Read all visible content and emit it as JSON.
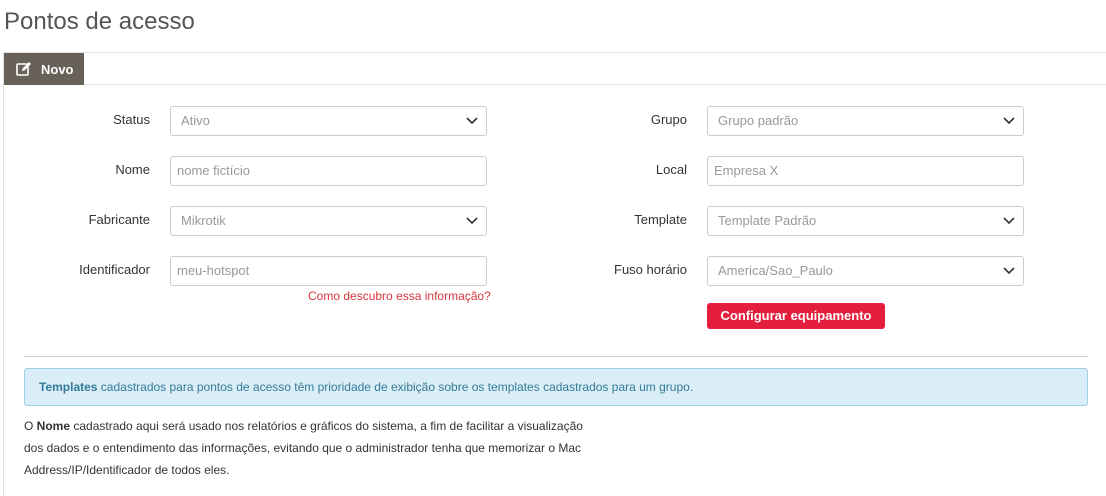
{
  "page": {
    "title": "Pontos de acesso"
  },
  "tabs": {
    "novo_label": "Novo"
  },
  "form": {
    "status": {
      "label": "Status",
      "value": "Ativo"
    },
    "nome": {
      "label": "Nome",
      "placeholder": "nome fictício"
    },
    "fabricante": {
      "label": "Fabricante",
      "value": "Mikrotik"
    },
    "identificador": {
      "label": "Identificador",
      "placeholder": "meu-hotspot"
    },
    "help_link": "Como descubro essa informação?",
    "grupo": {
      "label": "Grupo",
      "value": "Grupo padrão"
    },
    "local": {
      "label": "Local",
      "placeholder": "Empresa X"
    },
    "template": {
      "label": "Template",
      "value": "Template Padrão"
    },
    "fuso": {
      "label": "Fuso horário",
      "value": "America/Sao_Paulo"
    },
    "configure_button": "Configurar equipamento"
  },
  "info_alert": {
    "strong": "Templates",
    "text": " cadastrados para pontos de acesso têm prioridade de exibição sobre os templates cadastrados para um grupo."
  },
  "note": {
    "prefix": "O ",
    "strong": "Nome",
    "text": " cadastrado aqui será usado nos relatórios e gráficos do sistema, a fim de facilitar a visualização dos dados e o entendimento das informações, evitando que o administrador tenha que memorizar o Mac Address/IP/Identificador de todos eles."
  },
  "colors": {
    "tab_bg": "#676158",
    "primary_button": "#e41f3d",
    "help_link": "#d9363e",
    "alert_bg": "#d9eef6",
    "alert_text": "#357a9a"
  },
  "icons": {
    "tab_icon": "edit-icon",
    "select_arrow": "chevron-down-icon"
  }
}
